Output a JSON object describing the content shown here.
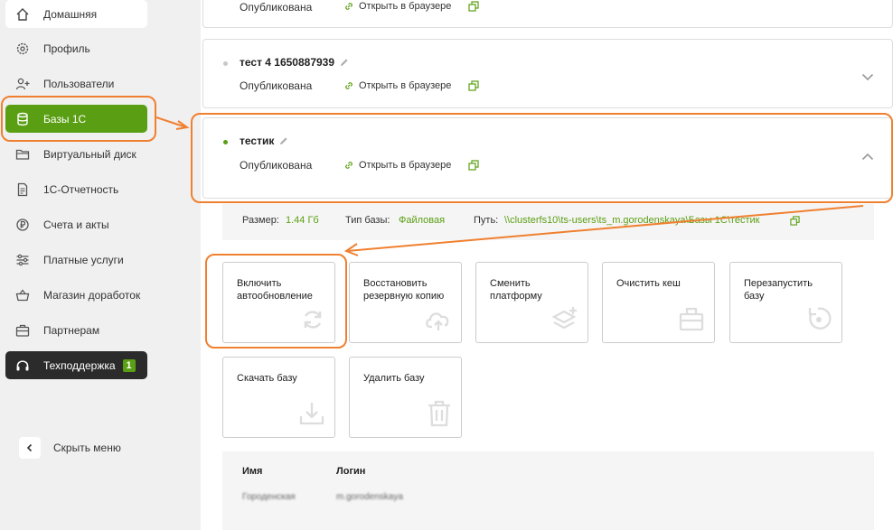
{
  "sidebar": {
    "items": [
      {
        "label": "Домашняя",
        "icon": "home-icon"
      },
      {
        "label": "Профиль",
        "icon": "gear-icon"
      },
      {
        "label": "Пользователи",
        "icon": "add-user-icon"
      },
      {
        "label": "Базы 1С",
        "icon": "database-icon"
      },
      {
        "label": "Виртуальный диск",
        "icon": "folder-icon"
      },
      {
        "label": "1С-Отчетность",
        "icon": "document-icon"
      },
      {
        "label": "Счета и акты",
        "icon": "ruble-icon"
      },
      {
        "label": "Платные услуги",
        "icon": "sliders-icon"
      },
      {
        "label": "Магазин доработок",
        "icon": "basket-icon"
      },
      {
        "label": "Партнерам",
        "icon": "briefcase-icon"
      },
      {
        "label": "Техподдержка",
        "icon": "headset-icon",
        "badge": "1"
      }
    ],
    "collapse_label": "Скрыть меню"
  },
  "databases": [
    {
      "name": "",
      "status": "Опубликована",
      "link": "Открыть в браузере"
    },
    {
      "name": "тест 4 1650887939",
      "status": "Опубликована",
      "link": "Открыть в браузере"
    },
    {
      "name": "тестик",
      "status": "Опубликована",
      "link": "Открыть в браузере"
    }
  ],
  "details": {
    "size_label": "Размер:",
    "size_value": "1.44 Гб",
    "type_label": "Тип базы:",
    "type_value": "Файловая",
    "path_label": "Путь:",
    "path_value": "\\\\clusterfs10\\ts-users\\ts_m.gorodenskaya\\Базы 1С\\тестик"
  },
  "actions": [
    {
      "label": "Включить автообновление",
      "icon": "refresh-icon"
    },
    {
      "label": "Восстановить резервную копию",
      "icon": "cloud-upload-icon"
    },
    {
      "label": "Сменить платформу",
      "icon": "layers-plus-icon"
    },
    {
      "label": "Очистить кеш",
      "icon": "briefcase-icon"
    },
    {
      "label": "Перезапустить базу",
      "icon": "restart-icon"
    },
    {
      "label": "Скачать базу",
      "icon": "download-icon"
    },
    {
      "label": "Удалить базу",
      "icon": "trash-icon"
    }
  ],
  "users_table": {
    "col_name": "Имя",
    "col_login": "Логин",
    "row_name": "Городенская",
    "row_login": "m.gorodenskaya"
  },
  "colors": {
    "accent": "#5a9f13",
    "annotation": "#f08030"
  }
}
